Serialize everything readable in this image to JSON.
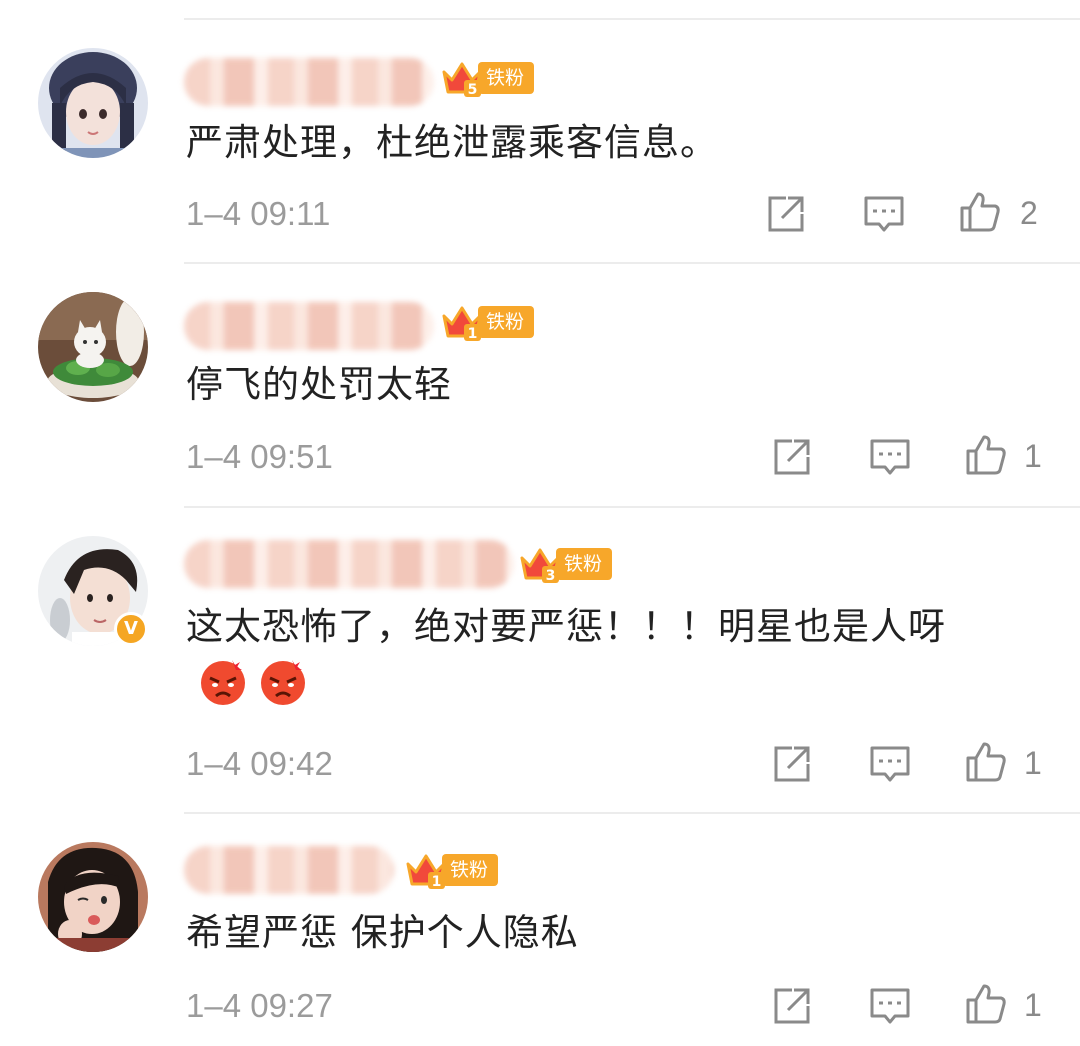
{
  "comments": [
    {
      "username": "",
      "badge_level": "5",
      "badge_label": "铁粉",
      "text": "严肃处理，杜绝泄露乘客信息。",
      "time": "1–4 09:11",
      "likes": "2",
      "verified": false
    },
    {
      "username": "",
      "badge_level": "1",
      "badge_label": "铁粉",
      "text": "停飞的处罚太轻",
      "time": "1–4 09:51",
      "likes": "1",
      "verified": false
    },
    {
      "username": "",
      "badge_level": "3",
      "badge_label": "铁粉",
      "text": "这太恐怖了，绝对要严惩！！！明星也是人呀",
      "emojis": [
        "angry-emoji",
        "angry-emoji"
      ],
      "time": "1–4 09:42",
      "likes": "1",
      "verified": true,
      "verified_mark": "V"
    },
    {
      "username": "",
      "badge_level": "1",
      "badge_label": "铁粉",
      "text": "希望严惩  保护个人隐私",
      "time": "1–4 09:27",
      "likes": "1",
      "verified": false
    }
  ],
  "icons": {
    "repost": "repost-icon",
    "reply": "reply-icon",
    "like": "thumbs-up-icon",
    "badge": "crown-icon"
  },
  "colors": {
    "badge": "#f7a72a",
    "text": "#222222",
    "meta": "#9b9b9b",
    "divider": "#ececec"
  }
}
